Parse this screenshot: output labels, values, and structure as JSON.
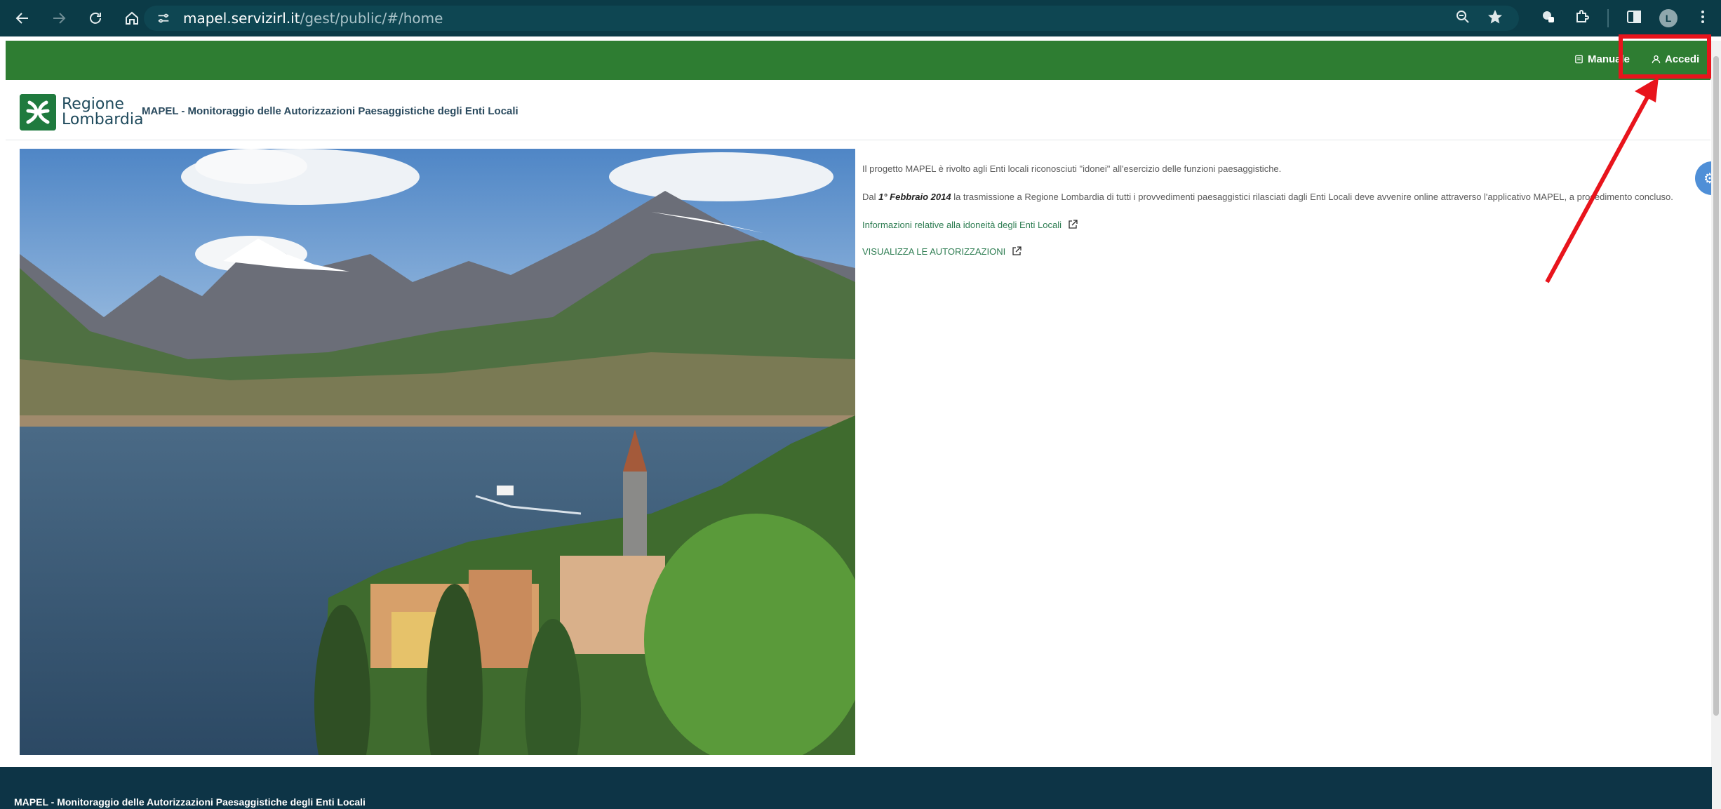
{
  "browser": {
    "url_domain": "mapel.servizirl.it",
    "url_path": "/gest/public/#/home",
    "profile_initial": "L"
  },
  "header": {
    "manual_label": "Manuale",
    "login_label": "Accedi",
    "accent_color": "#2e7d32"
  },
  "brand": {
    "logo_line1": "Regione",
    "logo_line2": "Lombardia",
    "app_title": "MAPEL - Monitoraggio delle Autorizzazioni Paesaggistiche degli Enti Locali"
  },
  "content": {
    "intro": "Il progetto MAPEL è rivolto agli Enti locali riconosciuti \"idonei\" all'esercizio delle funzioni paesaggistiche.",
    "para2_pre": "Dal ",
    "para2_date": "1° Febbraio 2014",
    "para2_post": " la trasmissione a Regione Lombardia di tutti i provvedimenti paesaggistici rilasciati dagli Enti Locali deve avvenire online attraverso l'applicativo MAPEL, a procedimento concluso.",
    "link_info": "Informazioni relative alla idoneità degli Enti Locali",
    "link_view": "VISUALIZZA LE AUTORIZZAZIONI"
  },
  "footer": {
    "title": "MAPEL - Monitoraggio delle Autorizzazioni Paesaggistiche degli Enti Locali"
  }
}
